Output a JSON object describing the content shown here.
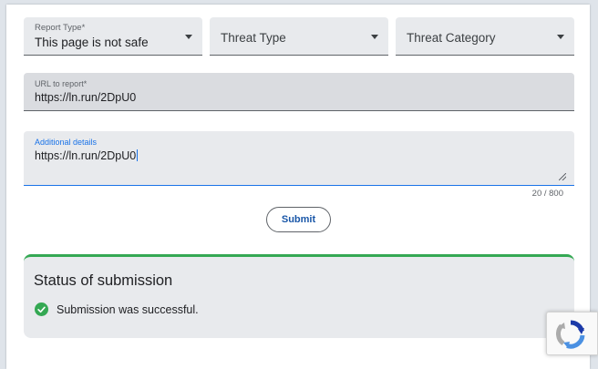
{
  "report_type": {
    "label": "Report Type*",
    "value": "This page is not safe"
  },
  "threat_type": {
    "placeholder": "Threat Type"
  },
  "threat_category": {
    "placeholder": "Threat Category"
  },
  "url_field": {
    "label": "URL to report*",
    "value": "https://ln.run/2DpU0"
  },
  "details_field": {
    "label": "Additional details",
    "value": "https://ln.run/2DpU0",
    "counter": "20 / 800"
  },
  "submit": {
    "label": "Submit"
  },
  "status": {
    "title": "Status of submission",
    "message": "Submission was successful.",
    "color": "#34a853"
  },
  "icons": {
    "dropdown": "chevron-down-icon",
    "success": "check-circle-icon",
    "recaptcha": "recaptcha-logo-icon"
  },
  "colors": {
    "accent": "#1a73e8",
    "success": "#34a853",
    "field_bg": "#e8eaed"
  }
}
